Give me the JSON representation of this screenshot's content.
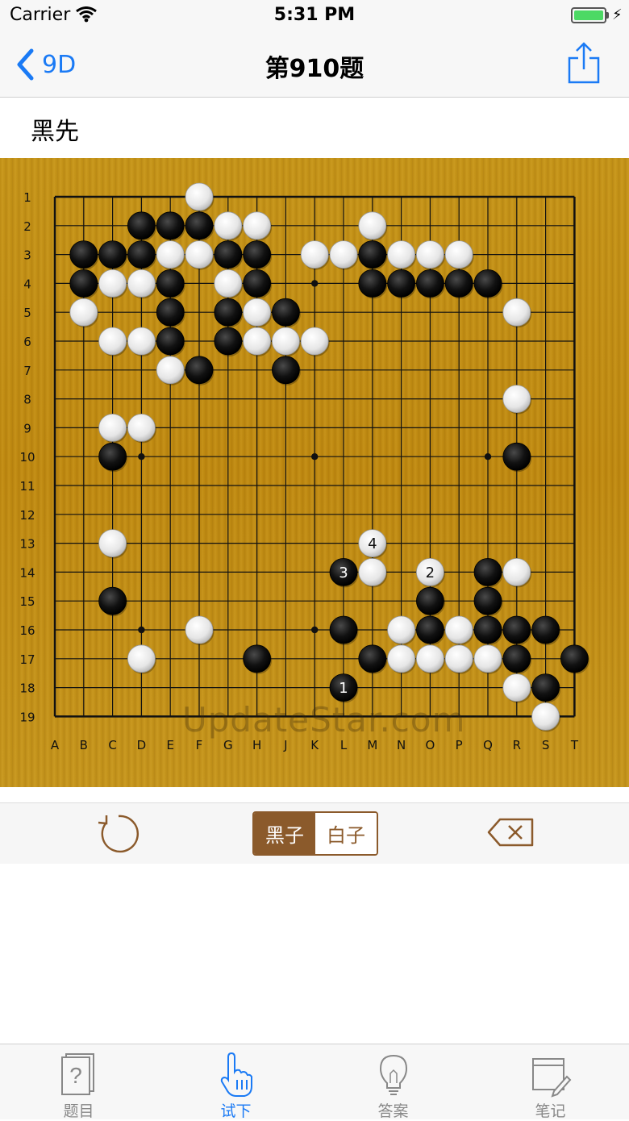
{
  "status_bar": {
    "carrier": "Carrier",
    "time": "5:31 PM",
    "battery_level": 1.0
  },
  "nav": {
    "back_label": "9D",
    "title": "第910题"
  },
  "problem": {
    "prompt": "黑先"
  },
  "board": {
    "size": 19,
    "col_labels": [
      "A",
      "B",
      "C",
      "D",
      "E",
      "F",
      "G",
      "H",
      "J",
      "K",
      "L",
      "M",
      "N",
      "O",
      "P",
      "Q",
      "R",
      "S",
      "T"
    ],
    "row_labels": [
      "1",
      "2",
      "3",
      "4",
      "5",
      "6",
      "7",
      "8",
      "9",
      "10",
      "11",
      "12",
      "13",
      "14",
      "15",
      "16",
      "17",
      "18",
      "19"
    ],
    "stones": [
      [
        "W",
        "F1"
      ],
      [
        "B",
        "D2"
      ],
      [
        "B",
        "E2"
      ],
      [
        "B",
        "F2"
      ],
      [
        "W",
        "G2"
      ],
      [
        "W",
        "H2"
      ],
      [
        "W",
        "M2"
      ],
      [
        "B",
        "B3"
      ],
      [
        "B",
        "C3"
      ],
      [
        "B",
        "D3"
      ],
      [
        "W",
        "E3"
      ],
      [
        "W",
        "F3"
      ],
      [
        "B",
        "G3"
      ],
      [
        "B",
        "H3"
      ],
      [
        "W",
        "K3"
      ],
      [
        "W",
        "L3"
      ],
      [
        "B",
        "M3"
      ],
      [
        "W",
        "N3"
      ],
      [
        "W",
        "O3"
      ],
      [
        "W",
        "P3"
      ],
      [
        "B",
        "B4"
      ],
      [
        "W",
        "C4"
      ],
      [
        "W",
        "D4"
      ],
      [
        "B",
        "E4"
      ],
      [
        "W",
        "G4"
      ],
      [
        "B",
        "H4"
      ],
      [
        "B",
        "M4"
      ],
      [
        "B",
        "N4"
      ],
      [
        "B",
        "O4"
      ],
      [
        "B",
        "P4"
      ],
      [
        "B",
        "Q4"
      ],
      [
        "W",
        "B5"
      ],
      [
        "B",
        "E5"
      ],
      [
        "B",
        "G5"
      ],
      [
        "W",
        "H5"
      ],
      [
        "B",
        "J5"
      ],
      [
        "W",
        "R5"
      ],
      [
        "W",
        "C6"
      ],
      [
        "W",
        "D6"
      ],
      [
        "B",
        "E6"
      ],
      [
        "B",
        "G6"
      ],
      [
        "W",
        "H6"
      ],
      [
        "W",
        "J6"
      ],
      [
        "W",
        "K6"
      ],
      [
        "W",
        "E7"
      ],
      [
        "B",
        "F7"
      ],
      [
        "B",
        "J7"
      ],
      [
        "W",
        "R8"
      ],
      [
        "W",
        "C9"
      ],
      [
        "W",
        "D9"
      ],
      [
        "B",
        "C10"
      ],
      [
        "B",
        "R10"
      ],
      [
        "W",
        "C13"
      ],
      [
        "W",
        "M14"
      ],
      [
        "W",
        "R14"
      ],
      [
        "B",
        "Q14"
      ],
      [
        "B",
        "C15"
      ],
      [
        "B",
        "O15"
      ],
      [
        "B",
        "Q15"
      ],
      [
        "W",
        "F16"
      ],
      [
        "B",
        "L16"
      ],
      [
        "W",
        "N16"
      ],
      [
        "B",
        "O16"
      ],
      [
        "W",
        "P16"
      ],
      [
        "B",
        "Q16"
      ],
      [
        "B",
        "R16"
      ],
      [
        "B",
        "S16"
      ],
      [
        "W",
        "D17"
      ],
      [
        "B",
        "H17"
      ],
      [
        "B",
        "M17"
      ],
      [
        "W",
        "N17"
      ],
      [
        "W",
        "O17"
      ],
      [
        "W",
        "P17"
      ],
      [
        "W",
        "Q17"
      ],
      [
        "B",
        "R17"
      ],
      [
        "B",
        "T17"
      ],
      [
        "W",
        "R18"
      ],
      [
        "B",
        "S18"
      ],
      [
        "W",
        "S19"
      ]
    ],
    "move_stones": [
      [
        "B",
        "L18",
        "1"
      ],
      [
        "W",
        "O14",
        "2"
      ],
      [
        "B",
        "L14",
        "3"
      ],
      [
        "W",
        "M13",
        "4"
      ]
    ],
    "hoshi": [
      "K4",
      "D10",
      "K10",
      "Q10",
      "D16",
      "K16"
    ],
    "watermark": "UpdateStar.com"
  },
  "toolbar": {
    "black_label": "黑子",
    "white_label": "白子",
    "selected": "black"
  },
  "tabs": [
    {
      "label": "题目",
      "icon": "question-card-icon",
      "active": false
    },
    {
      "label": "试下",
      "icon": "hand-pointer-icon",
      "active": true
    },
    {
      "label": "答案",
      "icon": "lightbulb-icon",
      "active": false
    },
    {
      "label": "笔记",
      "icon": "notepad-pencil-icon",
      "active": false
    }
  ],
  "colors": {
    "accent": "#1a7af5",
    "brown": "#8b5a2b",
    "board": "#c38e14"
  }
}
